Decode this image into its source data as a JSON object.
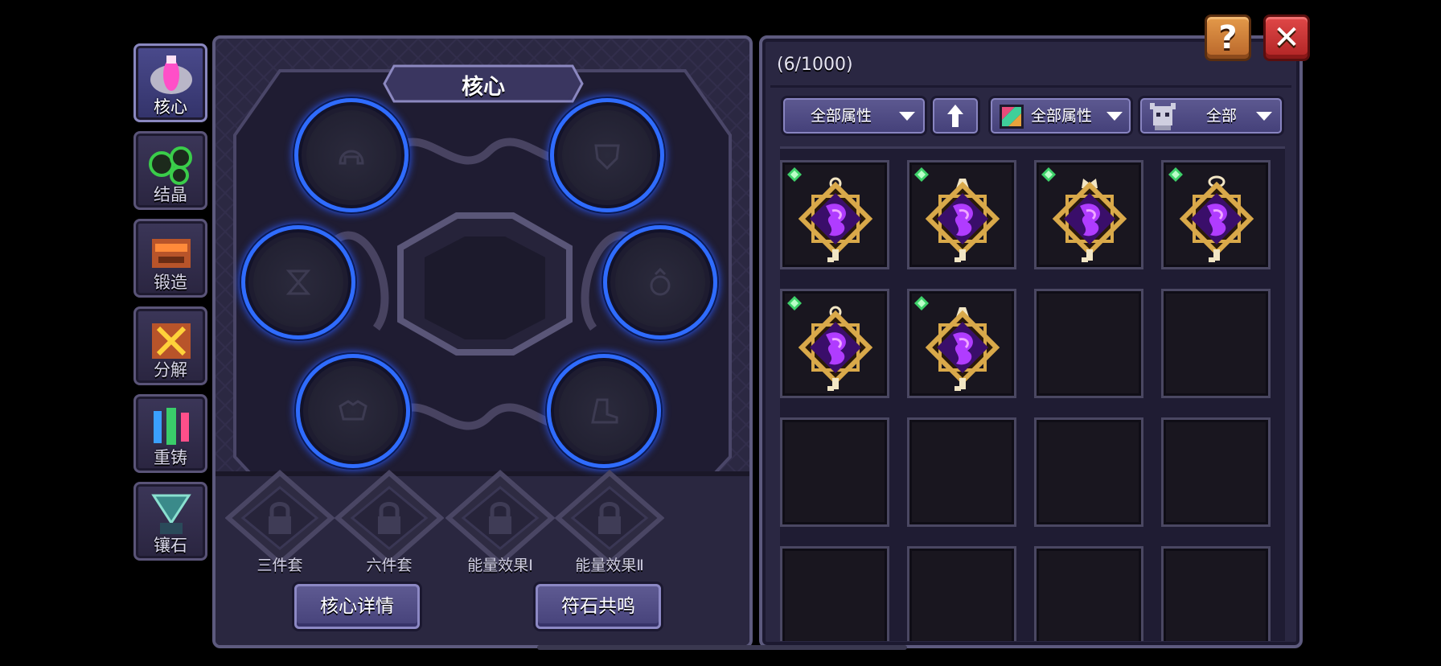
{
  "side_tabs": [
    {
      "label": "核心",
      "active": true
    },
    {
      "label": "结晶",
      "active": false
    },
    {
      "label": "锻造",
      "active": false
    },
    {
      "label": "分解",
      "active": false
    },
    {
      "label": "重铸",
      "active": false
    },
    {
      "label": "镶石",
      "active": false
    }
  ],
  "core_panel": {
    "title": "核心",
    "sockets": [
      {
        "slot": "helmet",
        "icon": "helmet-outline-icon"
      },
      {
        "slot": "chest",
        "icon": "shield-outline-icon"
      },
      {
        "slot": "gloves",
        "icon": "hourglass-outline-icon"
      },
      {
        "slot": "ring",
        "icon": "ring-outline-icon"
      },
      {
        "slot": "shoulder",
        "icon": "armor-outline-icon"
      },
      {
        "slot": "boots",
        "icon": "boot-outline-icon"
      }
    ],
    "set_slots": [
      {
        "label": "三件套",
        "locked": true
      },
      {
        "label": "六件套",
        "locked": true
      },
      {
        "label": "能量效果Ⅰ",
        "locked": true
      },
      {
        "label": "能量效果Ⅱ",
        "locked": true
      }
    ],
    "buttons": {
      "details": "核心详情",
      "resonance": "符石共鸣"
    }
  },
  "inventory": {
    "count": "(6/1000)",
    "filters": {
      "attribute": "全部属性",
      "element": "全部属性",
      "type": "全部"
    },
    "items": [
      {
        "name": "purple-core-amulet",
        "top": "ring-top",
        "badge": true
      },
      {
        "name": "purple-core-amulet",
        "top": "bell-top",
        "badge": true
      },
      {
        "name": "purple-core-amulet",
        "top": "crown-top",
        "badge": true
      },
      {
        "name": "purple-core-amulet",
        "top": "loop-top",
        "badge": true
      },
      {
        "name": "purple-core-amulet",
        "top": "ring-top",
        "badge": true
      },
      {
        "name": "purple-core-amulet",
        "top": "bell-top",
        "badge": true
      }
    ],
    "total_visible_cells": 16
  },
  "colors": {
    "socket_ring": "#2f6cff",
    "item_gem": "#b03cff",
    "item_frame": "#d9a94a",
    "badge_green": "#3ed26a"
  }
}
